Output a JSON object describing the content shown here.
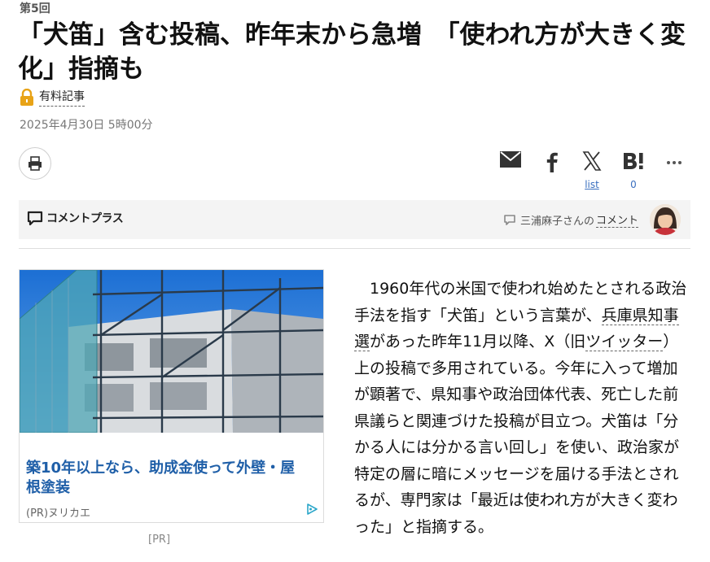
{
  "article": {
    "series": "第5回",
    "title": "「犬笛」含む投稿、昨年末から急増　「使われ方が大きく変化」指摘も",
    "premium_label": "有料記事",
    "date": "2025年4月30日 5時00分"
  },
  "share": {
    "mail_icon": "mail-icon",
    "facebook_icon": "facebook-icon",
    "x_icon": "x-icon",
    "hatena_icon": "hatena-bookmark-icon",
    "more_icon": "more-icon",
    "x_count_label": "list",
    "hatena_count": "0"
  },
  "comment_plus": {
    "label": "コメントプラス",
    "commenter_name": "三浦麻子さんの",
    "commenter_link": "コメント"
  },
  "ad": {
    "headline": "築10年以上なら、助成金使って外壁・屋根塗装",
    "sponsor": "(PR)ヌリカエ",
    "pr_label": "[PR]"
  },
  "body": {
    "p1_a": "1960年代の米国で使われ始めたとされる政治手法を指す「犬笛」という言葉が、",
    "p1_link1": "兵庫県知事選",
    "p1_b": "があった昨年11月以降、X（旧",
    "p1_link2": "ツイッター",
    "p1_c": "）上の投稿で多用されている。今年に入って増加が顕著で、県知事や政治団体代表、死亡した前県議らと関連づけた投稿が目立つ。犬笛は「分かる人には分かる言い回し」を使い、政治家が特定の層に暗にメッセージを届ける手法とされるが、専門家は「最近は使われ方が大きく変わった」と指摘する。"
  },
  "colors": {
    "accent_blue": "#1f5fa8",
    "lock_gold": "#e8a317",
    "comment_bar_bg": "#f4f4f4"
  }
}
